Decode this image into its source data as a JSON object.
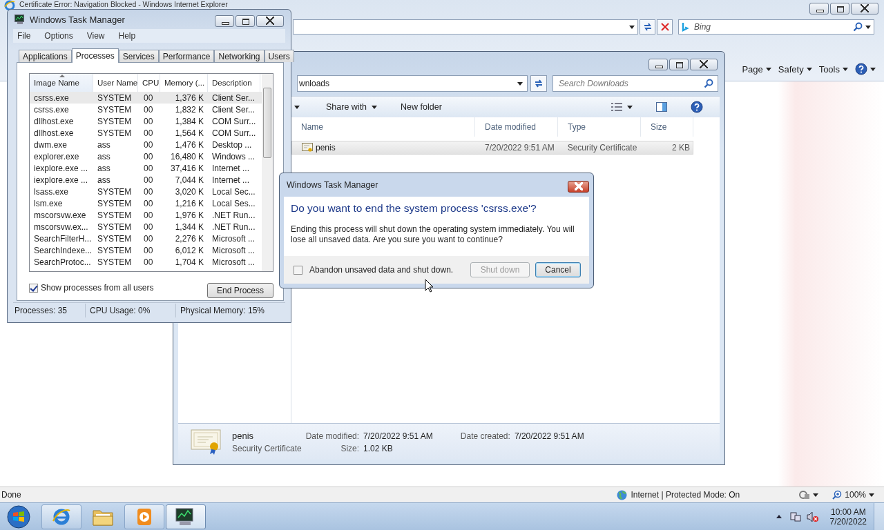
{
  "browser": {
    "title": "Certificate Error: Navigation Blocked - Windows Internet Explorer",
    "search": {
      "placeholder": "Bing"
    },
    "command_bar": [
      "Page",
      "Safety",
      "Tools"
    ],
    "status_bar": {
      "text": "Done",
      "zone": "Internet | Protected Mode: On",
      "zoom": "100%"
    }
  },
  "explorer": {
    "address": "wnloads",
    "search": {
      "placeholder": "Search Downloads"
    },
    "toolbar": [
      "Share with",
      "New folder"
    ],
    "columns": [
      "Name",
      "Date modified",
      "Type",
      "Size"
    ],
    "files": [
      {
        "name": "penis",
        "date_modified": "7/20/2022 9:51 AM",
        "type": "Security Certificate",
        "size": "2 KB",
        "selected": true
      }
    ],
    "details": {
      "name": "penis",
      "type": "Security Certificate",
      "date_modified_label": "Date modified:",
      "date_modified": "7/20/2022 9:51 AM",
      "size_label": "Size:",
      "size": "1.02 KB",
      "date_created_label": "Date created:",
      "date_created": "7/20/2022 9:51 AM"
    }
  },
  "task_manager": {
    "title": "Windows Task Manager",
    "menu": [
      "File",
      "Options",
      "View",
      "Help"
    ],
    "tabs": [
      {
        "label": "Applications",
        "selected": false
      },
      {
        "label": "Processes",
        "selected": true
      },
      {
        "label": "Services",
        "selected": false
      },
      {
        "label": "Performance",
        "selected": false
      },
      {
        "label": "Networking",
        "selected": false
      },
      {
        "label": "Users",
        "selected": false
      }
    ],
    "columns": [
      "Image Name",
      "User Name",
      "CPU",
      "Memory (...",
      "Description"
    ],
    "processes": [
      {
        "image": "csrss.exe",
        "user": "SYSTEM",
        "cpu": "00",
        "memory": "1,376 K",
        "description": "Client Ser...",
        "selected": true
      },
      {
        "image": "csrss.exe",
        "user": "SYSTEM",
        "cpu": "00",
        "memory": "1,832 K",
        "description": "Client Ser...",
        "selected": false
      },
      {
        "image": "dllhost.exe",
        "user": "SYSTEM",
        "cpu": "00",
        "memory": "1,384 K",
        "description": "COM Surr...",
        "selected": false
      },
      {
        "image": "dllhost.exe",
        "user": "SYSTEM",
        "cpu": "00",
        "memory": "1,564 K",
        "description": "COM Surr...",
        "selected": false
      },
      {
        "image": "dwm.exe",
        "user": "ass",
        "cpu": "00",
        "memory": "1,476 K",
        "description": "Desktop ...",
        "selected": false
      },
      {
        "image": "explorer.exe",
        "user": "ass",
        "cpu": "00",
        "memory": "16,480 K",
        "description": "Windows ...",
        "selected": false
      },
      {
        "image": "iexplore.exe ...",
        "user": "ass",
        "cpu": "00",
        "memory": "37,416 K",
        "description": "Internet ...",
        "selected": false
      },
      {
        "image": "iexplore.exe ...",
        "user": "ass",
        "cpu": "00",
        "memory": "7,044 K",
        "description": "Internet ...",
        "selected": false
      },
      {
        "image": "lsass.exe",
        "user": "SYSTEM",
        "cpu": "00",
        "memory": "3,020 K",
        "description": "Local Sec...",
        "selected": false
      },
      {
        "image": "lsm.exe",
        "user": "SYSTEM",
        "cpu": "00",
        "memory": "1,216 K",
        "description": "Local Ses...",
        "selected": false
      },
      {
        "image": "mscorsvw.exe",
        "user": "SYSTEM",
        "cpu": "00",
        "memory": "1,976 K",
        "description": ".NET Run...",
        "selected": false
      },
      {
        "image": "mscorsvw.ex...",
        "user": "SYSTEM",
        "cpu": "00",
        "memory": "1,344 K",
        "description": ".NET Run...",
        "selected": false
      },
      {
        "image": "SearchFilterH...",
        "user": "SYSTEM",
        "cpu": "00",
        "memory": "2,276 K",
        "description": "Microsoft ...",
        "selected": false
      },
      {
        "image": "SearchIndexe...",
        "user": "SYSTEM",
        "cpu": "00",
        "memory": "6,012 K",
        "description": "Microsoft ...",
        "selected": false
      },
      {
        "image": "SearchProtoc...",
        "user": "SYSTEM",
        "cpu": "00",
        "memory": "1,704 K",
        "description": "Microsoft ...",
        "selected": false
      }
    ],
    "show_all_users": {
      "label": "Show processes from all users",
      "checked": true
    },
    "end_process": "End Process",
    "status_bar": [
      "Processes: 35",
      "CPU Usage: 0%",
      "Physical Memory: 15%"
    ]
  },
  "dialog": {
    "title": "Windows Task Manager",
    "heading": "Do you want to end the system process 'csrss.exe'?",
    "message": "Ending this process will shut down the operating system immediately.  You will lose all unsaved data.  Are you sure you want to continue?",
    "checkbox": {
      "label": "Abandon unsaved data and shut down.",
      "checked": false
    },
    "buttons": [
      {
        "label": "Shut down",
        "disabled": true
      },
      {
        "label": "Cancel",
        "disabled": false
      }
    ]
  },
  "taskbar": {
    "apps": [
      {
        "kind": "browser",
        "selected": false
      },
      {
        "kind": "folder",
        "selected": false
      },
      {
        "kind": "media",
        "selected": false
      },
      {
        "kind": "monitor",
        "selected": true
      }
    ],
    "clock": {
      "time": "10:00 AM",
      "date": "7/20/2022"
    }
  }
}
